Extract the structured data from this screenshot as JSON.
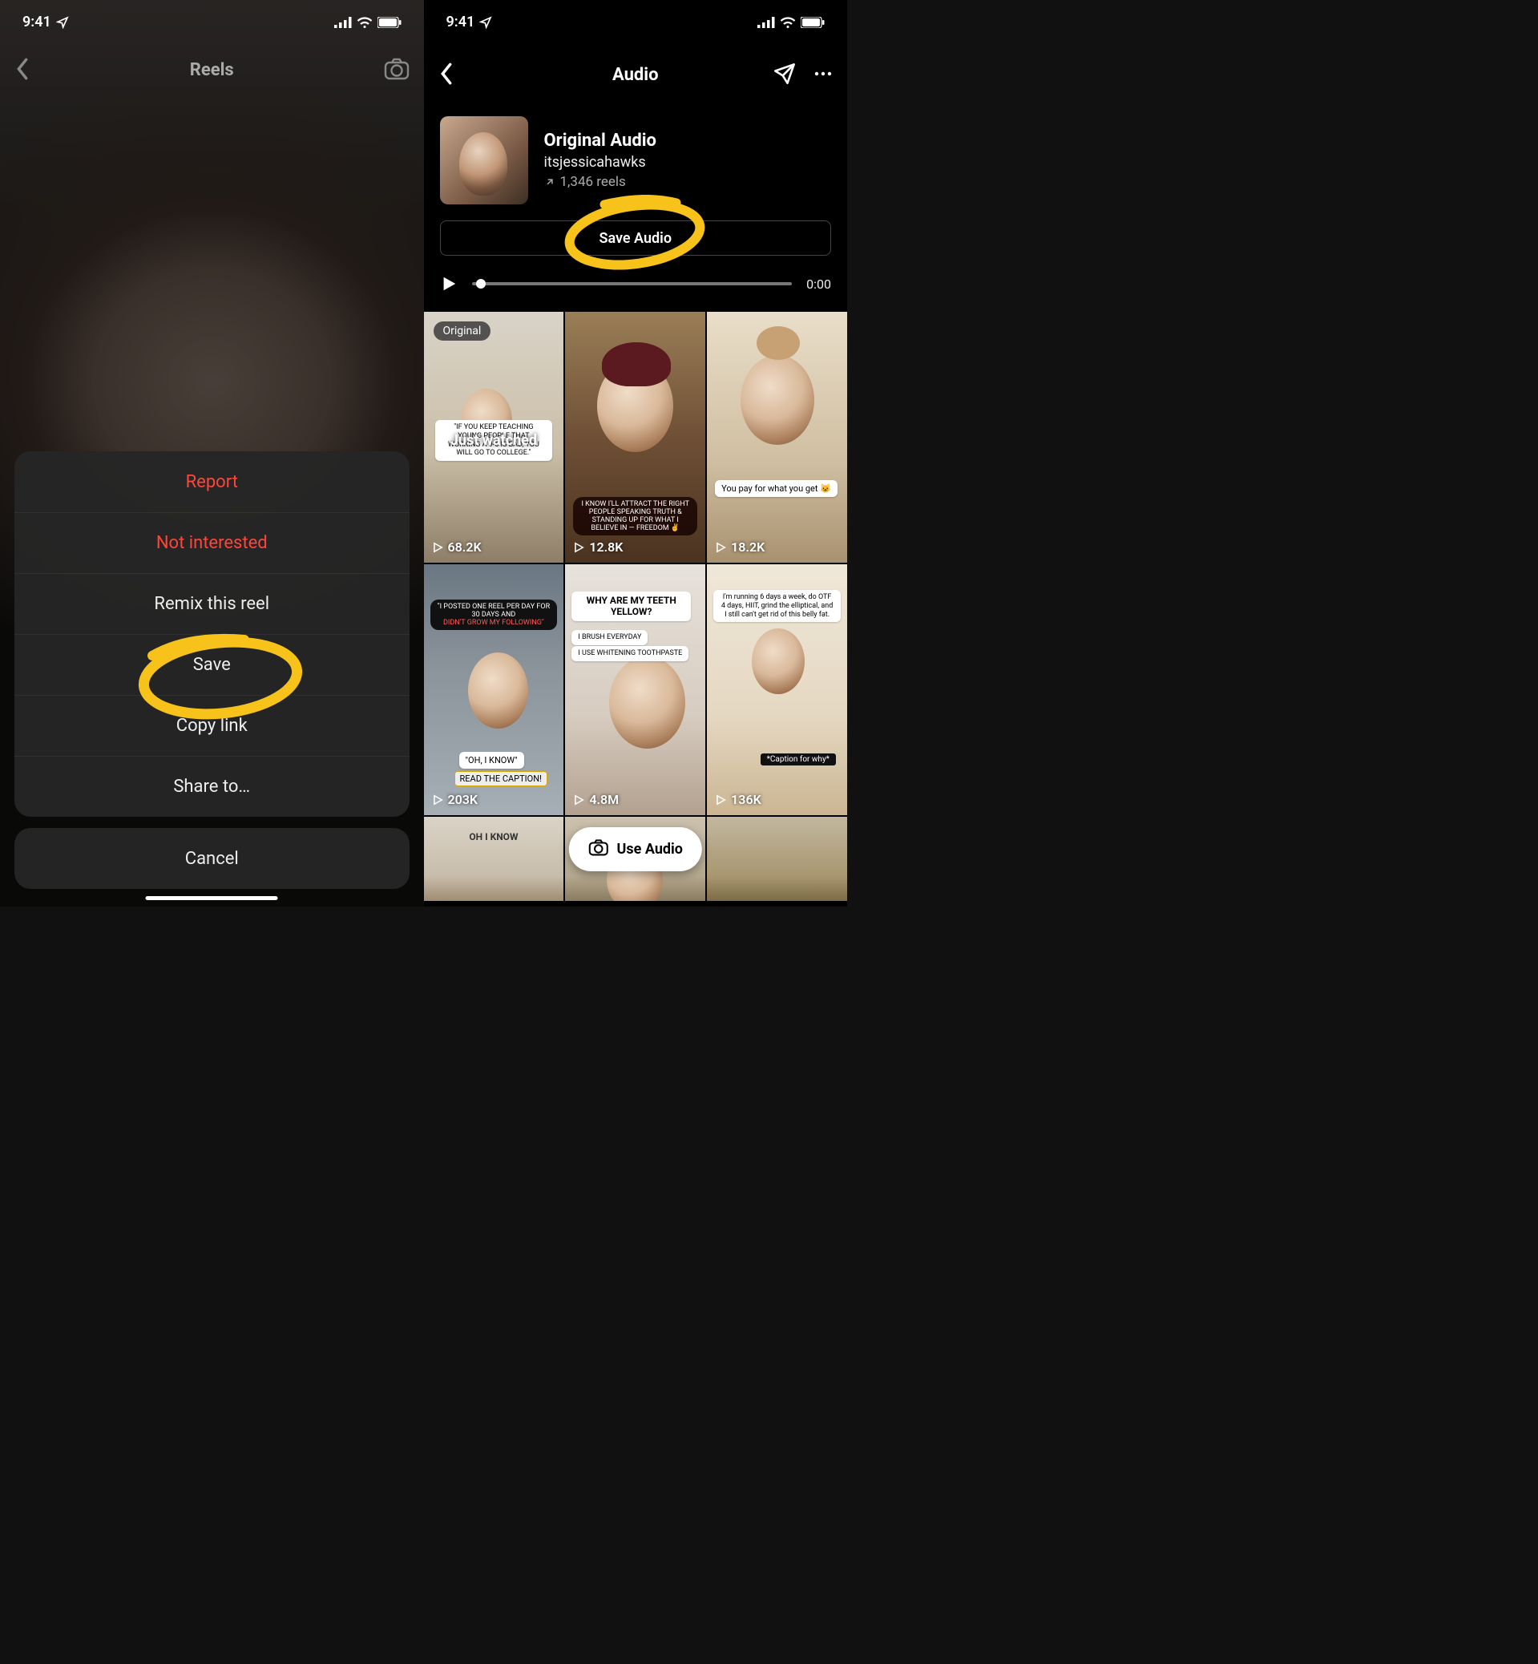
{
  "status": {
    "time": "9:41"
  },
  "left": {
    "headerTitle": "Reels",
    "sheet": {
      "report": "Report",
      "notInterested": "Not interested",
      "remix": "Remix this reel",
      "save": "Save",
      "copyLink": "Copy link",
      "shareTo": "Share to…",
      "cancel": "Cancel"
    }
  },
  "right": {
    "headerTitle": "Audio",
    "audio": {
      "title": "Original Audio",
      "artist": "itsjessicahawks",
      "reels": "1,346 reels",
      "saveBtn": "Save Audio",
      "time": "0:00"
    },
    "cells": [
      {
        "plays": "68.2K",
        "original": "Original",
        "caption": "\"IF YOU KEEP TEACHING YOUNG PEOPLE THAT WORKING A 9-5 IS BAD, YOU WILL GO TO COLLEGE.\"",
        "just": "Just watched"
      },
      {
        "plays": "12.8K",
        "caption": "I KNOW I'LL ATTRACT THE RIGHT PEOPLE SPEAKING TRUTH & STANDING UP FOR WHAT I BELIEVE IN — FREEDOM ✌️"
      },
      {
        "plays": "18.2K",
        "caption": "You pay for what you get 😺"
      },
      {
        "plays": "203K",
        "caption1": "\"I POSTED ONE REEL PER DAY FOR 30 DAYS AND",
        "caption1b": "DIDN'T GROW MY FOLLOWING\"",
        "caption2": "\"OH, I KNOW\"",
        "caption3": "READ THE CAPTION!"
      },
      {
        "plays": "4.8M",
        "caption1": "WHY ARE MY TEETH YELLOW?",
        "caption2": "I BRUSH EVERYDAY",
        "caption3": "I USE WHITENING TOOTHPASTE"
      },
      {
        "plays": "136K",
        "caption1": "I'm running 6 days a week, do OTF 4 days, HIIT, grind the elliptical, and I still can't get rid of this belly fat.",
        "caption2": "*Caption for why*"
      },
      {
        "small": "OH I KNOW"
      }
    ],
    "useAudio": "Use Audio"
  }
}
